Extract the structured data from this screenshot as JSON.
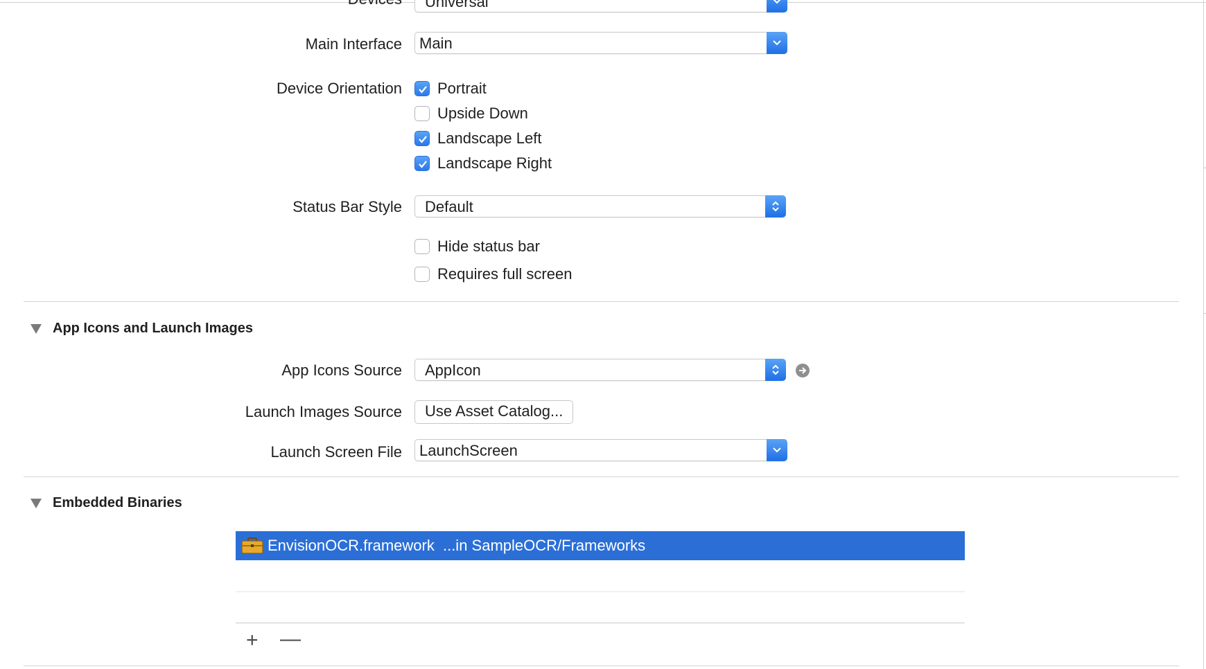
{
  "deployment": {
    "devices_label": "Devices",
    "devices_value": "Universal",
    "main_interface_label": "Main Interface",
    "main_interface_value": "Main",
    "device_orientation_label": "Device Orientation",
    "orientations": [
      {
        "label": "Portrait",
        "checked": true
      },
      {
        "label": "Upside Down",
        "checked": false
      },
      {
        "label": "Landscape Left",
        "checked": true
      },
      {
        "label": "Landscape Right",
        "checked": true
      }
    ],
    "status_bar_style_label": "Status Bar Style",
    "status_bar_style_value": "Default",
    "hide_status_bar": {
      "label": "Hide status bar",
      "checked": false
    },
    "requires_full_screen": {
      "label": "Requires full screen",
      "checked": false
    }
  },
  "app_icons": {
    "section_title": "App Icons and Launch Images",
    "icons_source_label": "App Icons Source",
    "icons_source_value": "AppIcon",
    "launch_images_label": "Launch Images Source",
    "launch_images_button": "Use Asset Catalog...",
    "launch_screen_label": "Launch Screen File",
    "launch_screen_value": "LaunchScreen"
  },
  "embedded_binaries": {
    "section_title": "Embedded Binaries",
    "items": [
      {
        "name": "EnvisionOCR.framework",
        "location": "...in SampleOCR/Frameworks"
      }
    ],
    "add_label": "+",
    "remove_label": "—"
  },
  "colors": {
    "accent": "#2b6fd6",
    "popup_cap": "#3b88f0"
  }
}
